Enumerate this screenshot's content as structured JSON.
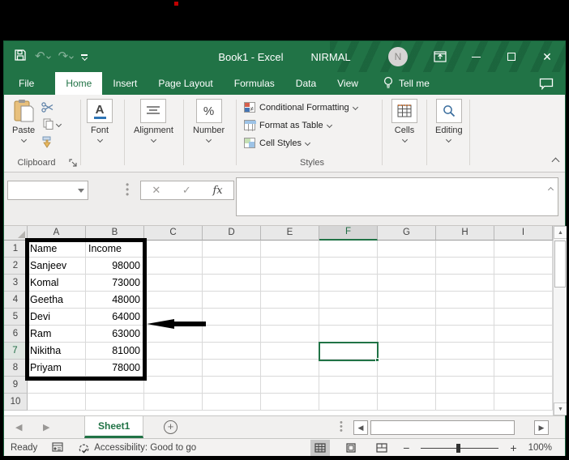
{
  "desktop": {
    "red_dot_color": "#c00000"
  },
  "title_bar": {
    "title": "Book1 - Excel",
    "user_name": "NIRMAL",
    "avatar_initial": "N"
  },
  "ribbon_tabs": {
    "items": [
      {
        "label": "File",
        "active": false
      },
      {
        "label": "Home",
        "active": true
      },
      {
        "label": "Insert",
        "active": false
      },
      {
        "label": "Page Layout",
        "active": false
      },
      {
        "label": "Formulas",
        "active": false
      },
      {
        "label": "Data",
        "active": false
      },
      {
        "label": "View",
        "active": false
      }
    ],
    "tell_me_label": "Tell me"
  },
  "ribbon": {
    "paste_label": "Paste",
    "clipboard_group_label": "Clipboard",
    "font_label": "Font",
    "alignment_label": "Alignment",
    "number_label": "Number",
    "styles_items": [
      "Conditional Formatting",
      "Format as Table",
      "Cell Styles"
    ],
    "styles_group_label": "Styles",
    "cells_label": "Cells",
    "editing_label": "Editing"
  },
  "formula_bar": {
    "name_box_value": "",
    "formula_value": "",
    "fx_label": "fx",
    "cancel_glyph": "✕",
    "enter_glyph": "✓"
  },
  "grid": {
    "column_headers": [
      "A",
      "B",
      "C",
      "D",
      "E",
      "F",
      "G",
      "H",
      "I"
    ],
    "row_headers": [
      "1",
      "2",
      "3",
      "4",
      "5",
      "6",
      "7",
      "8",
      "9",
      "10"
    ],
    "active_column": "F",
    "active_row": "7",
    "selected_cell": "F7",
    "cells": [
      [
        "Name",
        "Income"
      ],
      [
        "Sanjeev",
        "98000"
      ],
      [
        "Komal",
        "73000"
      ],
      [
        "Geetha",
        "48000"
      ],
      [
        "Devi",
        "64000"
      ],
      [
        "Ram",
        "63000"
      ],
      [
        "Nikitha",
        "81000"
      ],
      [
        "Priyam",
        "78000"
      ]
    ]
  },
  "sheet_bar": {
    "sheet_name": "Sheet1"
  },
  "status_bar": {
    "mode": "Ready",
    "accessibility_text": "Accessibility: Good to go",
    "zoom_level": "100%"
  },
  "colors": {
    "excel_green": "#217346"
  }
}
